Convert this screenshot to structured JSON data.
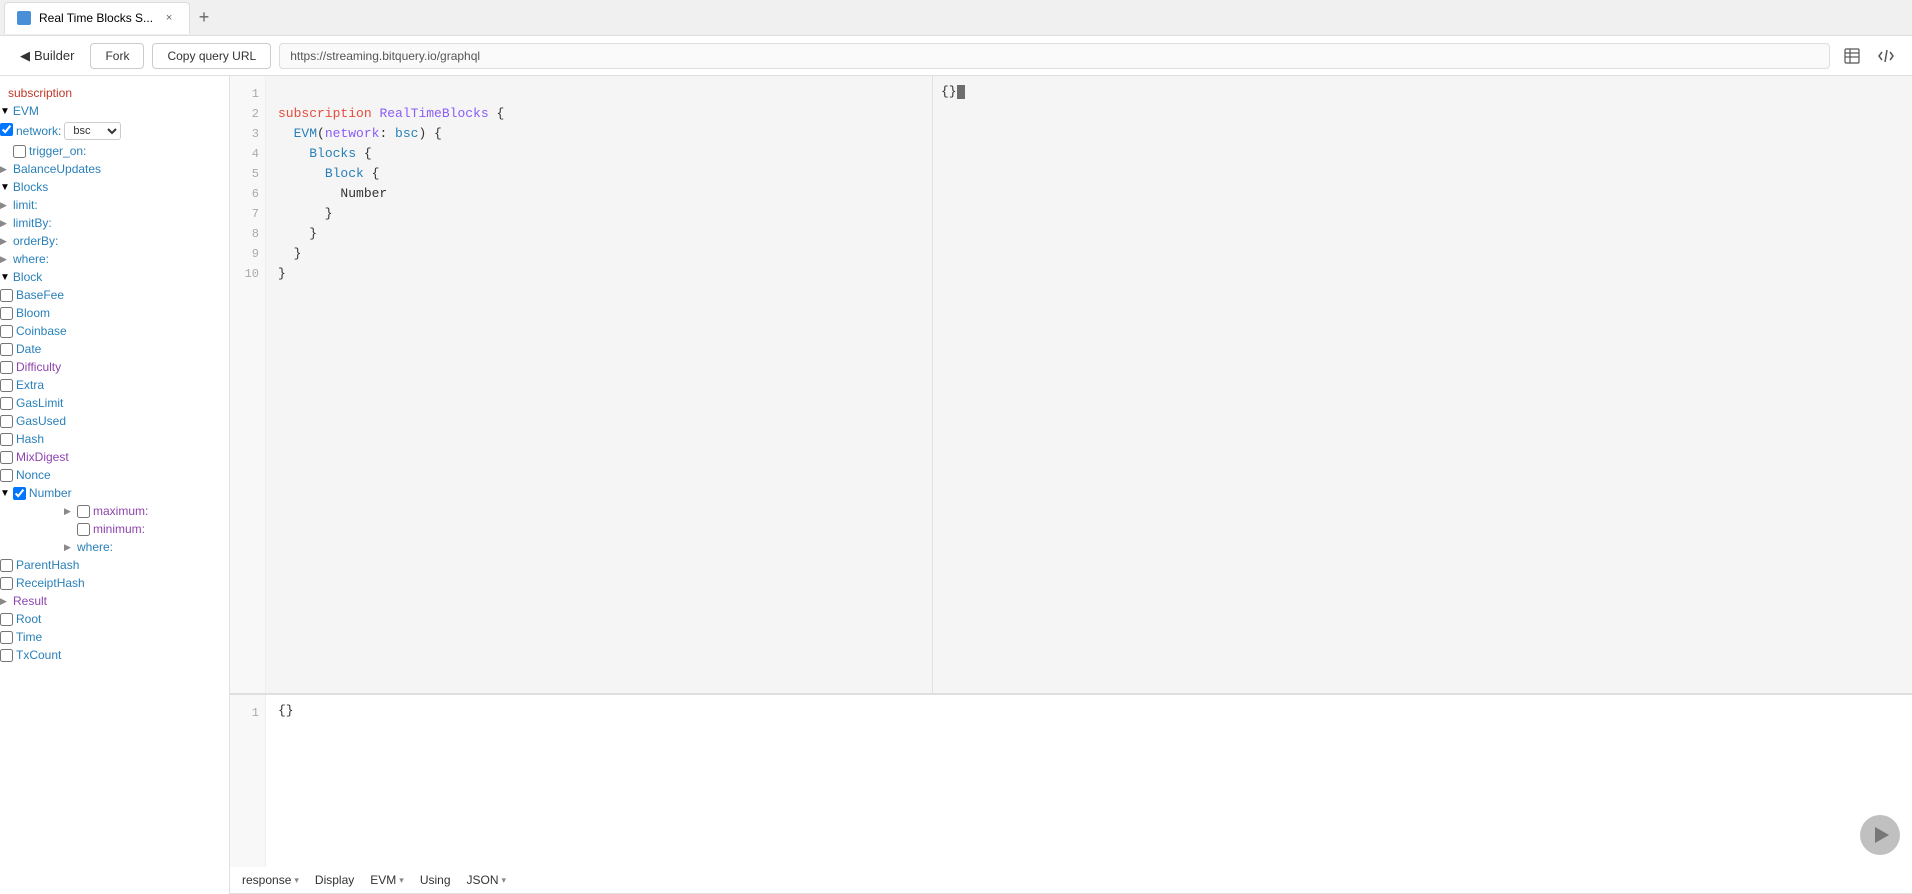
{
  "tab": {
    "favicon": "⬡",
    "title": "Real Time Blocks S...",
    "close": "×"
  },
  "toolbar": {
    "back_label": "Builder",
    "fork_label": "Fork",
    "copy_url_label": "Copy query URL",
    "url": "https://streaming.bitquery.io/graphql"
  },
  "sidebar": {
    "subscription_label": "subscription",
    "evm_label": "EVM",
    "network_label": "network:",
    "network_value": "bsc",
    "trigger_label": "trigger_on:",
    "balance_updates_label": "BalanceUpdates",
    "blocks_label": "Blocks",
    "limit_label": "limit:",
    "limit_by_label": "limitBy:",
    "order_by_label": "orderBy:",
    "where_label": "where:",
    "block_label": "Block",
    "base_fee_label": "BaseFee",
    "bloom_label": "Bloom",
    "coinbase_label": "Coinbase",
    "date_label": "Date",
    "difficulty_label": "Difficulty",
    "extra_label": "Extra",
    "gas_limit_label": "GasLimit",
    "gas_used_label": "GasUsed",
    "hash_label": "Hash",
    "mix_digest_label": "MixDigest",
    "nonce_label": "Nonce",
    "number_label": "Number",
    "maximum_label": "maximum:",
    "minimum_label": "minimum:",
    "where_sub_label": "where:",
    "parent_hash_label": "ParentHash",
    "receipt_hash_label": "ReceiptHash",
    "result_label": "Result",
    "root_label": "Root",
    "time_label": "Time",
    "tx_count_label": "TxCount"
  },
  "editor": {
    "lines": [
      1,
      2,
      3,
      4,
      5,
      6,
      7,
      8,
      9,
      10
    ],
    "code_lines": [
      {
        "num": 1,
        "content": "subscription RealTimeBlocks {"
      },
      {
        "num": 2,
        "content": "  EVM(network: bsc) {"
      },
      {
        "num": 3,
        "content": "    Blocks {"
      },
      {
        "num": 4,
        "content": "      Block {"
      },
      {
        "num": 5,
        "content": "        Number"
      },
      {
        "num": 6,
        "content": "      }"
      },
      {
        "num": 7,
        "content": "    }"
      },
      {
        "num": 8,
        "content": "  }"
      },
      {
        "num": 9,
        "content": "}"
      },
      {
        "num": 10,
        "content": ""
      }
    ]
  },
  "result_panel": {
    "response_label": "response",
    "display_label": "Display",
    "evm_label": "EVM",
    "using_label": "Using",
    "json_label": "JSON",
    "initial_content": "{}"
  },
  "right_panel": {
    "content": "{}"
  }
}
